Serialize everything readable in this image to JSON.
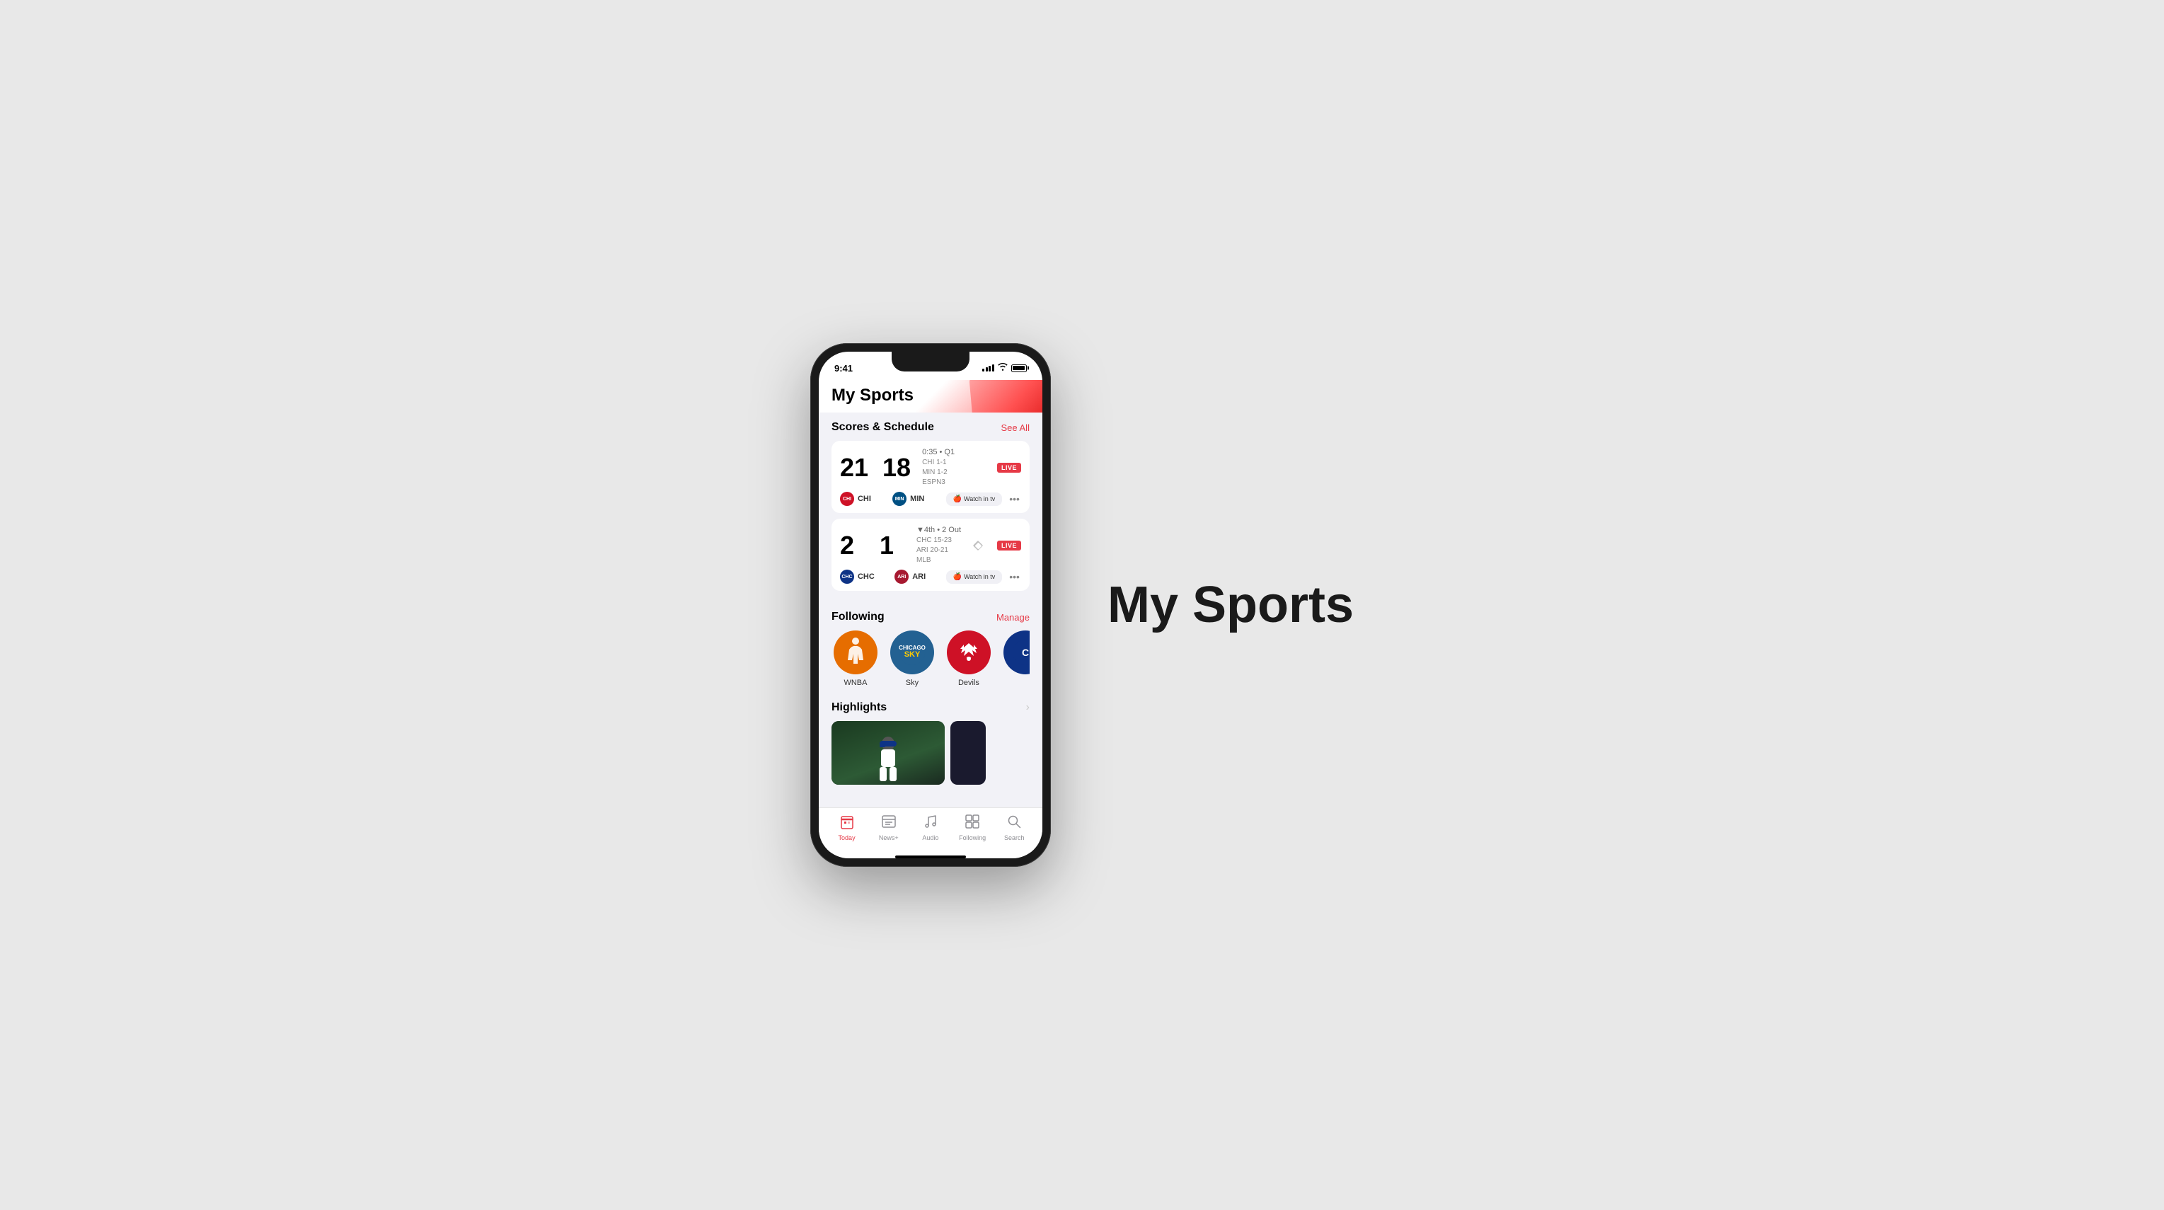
{
  "page": {
    "big_title": "My Sports"
  },
  "phone": {
    "status_bar": {
      "time": "9:41"
    },
    "app_title": "My Sports",
    "scores_section": {
      "title": "Scores & Schedule",
      "action": "See All",
      "game1": {
        "score_home": "21",
        "score_away": "18",
        "status": "0:35 • Q1",
        "home_record": "CHI 1-1",
        "away_record": "MIN 1-2",
        "network": "ESPN3",
        "home_team": "CHI",
        "away_team": "MIN",
        "live": "LIVE",
        "watch_label": "Watch in  tv"
      },
      "game2": {
        "score_home": "2",
        "score_away": "1",
        "status": "▼4th • 2 Out",
        "home_record": "CHC 15-23",
        "away_record": "ARI 20-21",
        "network": "MLB",
        "home_team": "CHC",
        "away_team": "ARI",
        "live": "LIVE",
        "watch_label": "Watch in  tv"
      }
    },
    "following_section": {
      "title": "Following",
      "action": "Manage",
      "teams": [
        {
          "name": "WNBA",
          "color": "#e66d00"
        },
        {
          "name": "Sky",
          "color": "#236192"
        },
        {
          "name": "Devils",
          "color": "#ce1126"
        },
        {
          "name": "Cubs",
          "color": "#0e3386"
        }
      ]
    },
    "highlights_section": {
      "title": "Highlights"
    },
    "tab_bar": {
      "tabs": [
        {
          "label": "Today",
          "active": true
        },
        {
          "label": "News+",
          "active": false
        },
        {
          "label": "Audio",
          "active": false
        },
        {
          "label": "Following",
          "active": false
        },
        {
          "label": "Search",
          "active": false
        }
      ]
    }
  }
}
